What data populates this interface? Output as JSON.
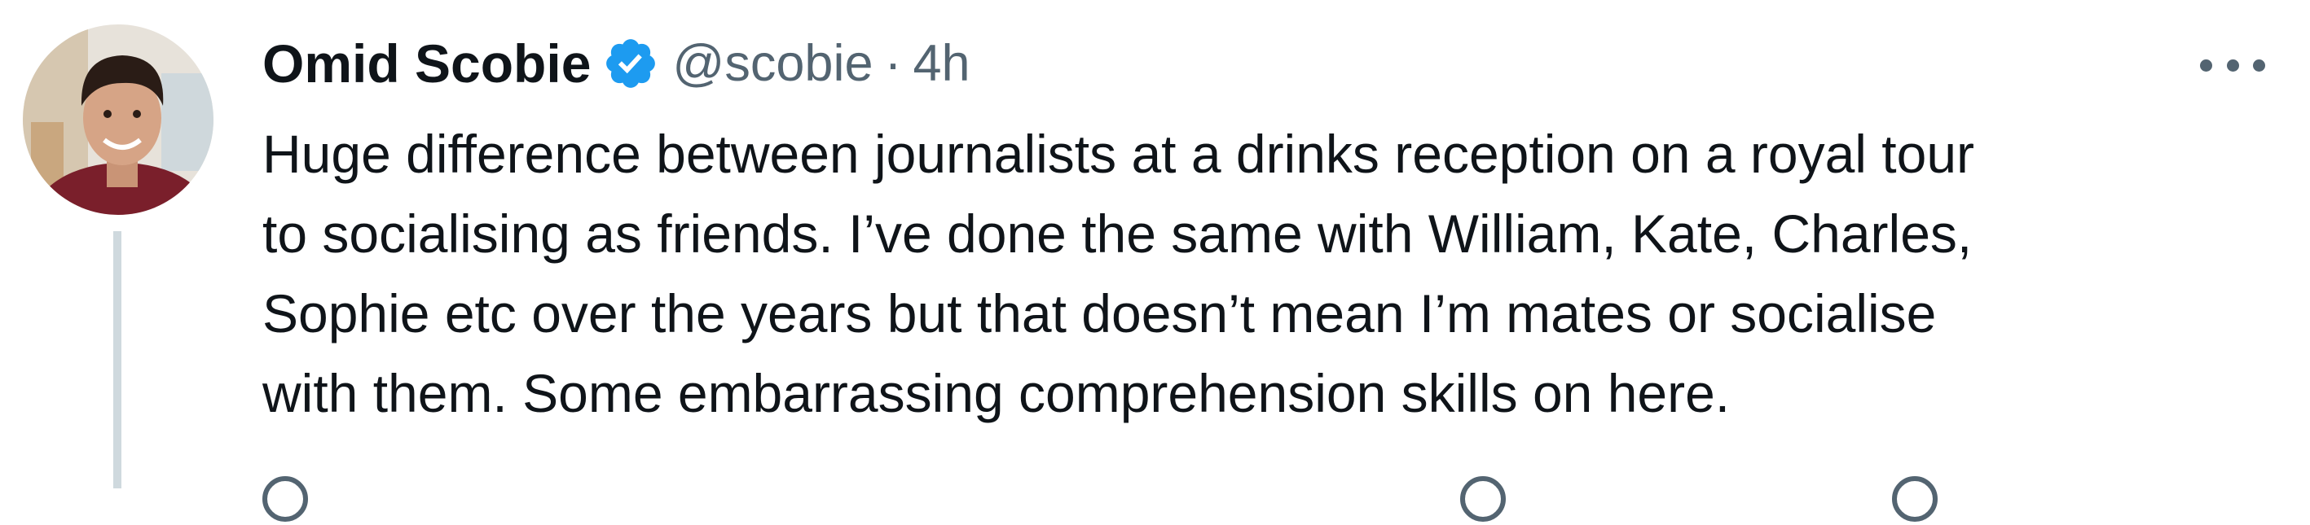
{
  "tweet": {
    "display_name": "Omid Scobie",
    "handle": "@scobie",
    "separator": "·",
    "time": "4h",
    "verified": true,
    "verified_color": "#1d9bf0",
    "text_lines": [
      "Huge difference between journalists at a drinks reception on a royal tour",
      "to socialising as friends. I’ve done the same with William, Kate, Charles,",
      "Sophie etc over the years but that doesn’t mean I’m mates or socialise",
      "with them. Some embarrassing comprehension skills on here."
    ],
    "more_icon": "more-horizontal-icon",
    "avatar": "profile-avatar",
    "action_icons": [
      "reply-icon",
      "retweet-icon",
      "like-icon",
      "views-icon"
    ]
  },
  "colors": {
    "primary_text": "#0f1419",
    "secondary_text": "#536471",
    "thread_line": "#cfd9de",
    "accent": "#1d9bf0"
  }
}
